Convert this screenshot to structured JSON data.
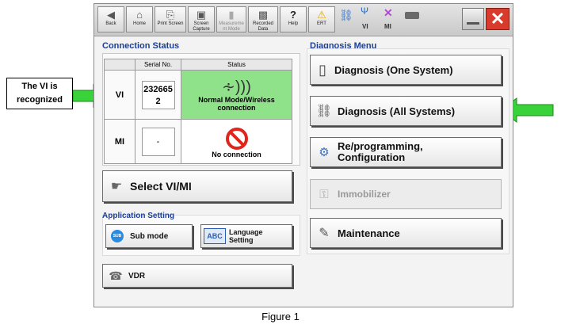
{
  "callout": {
    "line1": "The VI is",
    "line2": "recognized"
  },
  "caption": "Figure 1",
  "toolbar": {
    "back": "Back",
    "home": "Home",
    "print": "Print Screen",
    "capture": "Screen Capture",
    "measure": "Measureme nt Mode",
    "recorded": "Recorded Data",
    "help": "Help",
    "ert": "ERT",
    "vi": "VI",
    "mi": "MI"
  },
  "connection": {
    "title": "Connection Status",
    "headers": {
      "serial": "Serial No.",
      "status": "Status"
    },
    "vi": {
      "label": "VI",
      "serial_line1": "232665",
      "serial_line2": "2",
      "status": "Normal Mode/Wireless connection"
    },
    "mi": {
      "label": "MI",
      "serial": "-",
      "status": "No connection"
    },
    "select_button": "Select VI/MI"
  },
  "app_setting": {
    "title": "Application Setting",
    "sub_mode": "Sub mode",
    "sub_badge": "SUB",
    "language_line1": "Language",
    "language_line2": "Setting",
    "language_badge": "ABC",
    "vdr": "VDR"
  },
  "diagnosis": {
    "title": "Diagnosis Menu",
    "one_system": "Diagnosis (One System)",
    "all_systems": "Diagnosis (All Systems)",
    "reprog_line1": "Re/programming,",
    "reprog_line2": "Configuration",
    "immobilizer": "Immobilizer",
    "maintenance": "Maintenance"
  },
  "colors": {
    "vi_status_bg": "#8fe18a",
    "arrow_green": "#39d23a",
    "title_blue": "#1c3f95",
    "close_red": "#d83b2b"
  }
}
